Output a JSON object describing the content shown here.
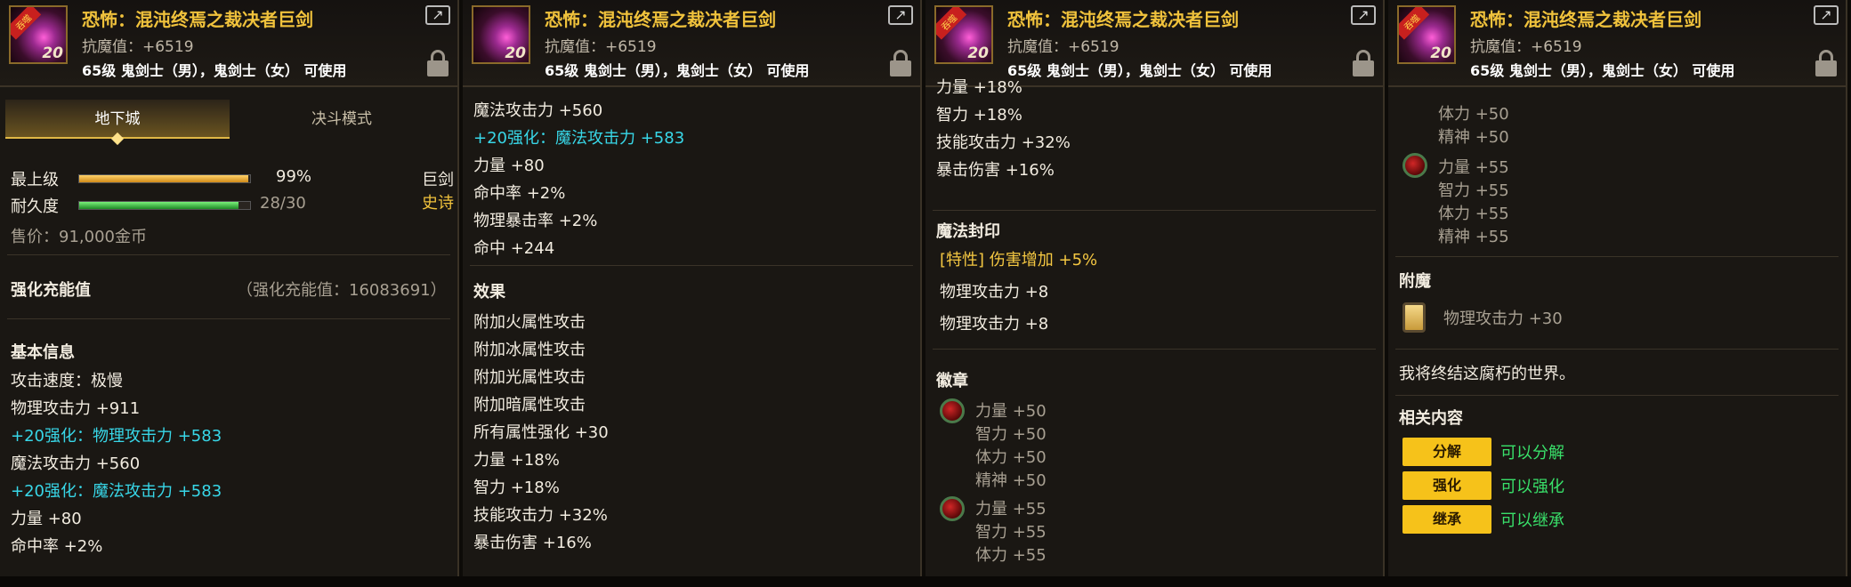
{
  "item": {
    "name": "恐怖：混沌终焉之裁决者巨剑",
    "resist": "抗魔值：+6519",
    "usable": "65级 鬼剑士（男），鬼剑士（女） 可使用",
    "level_badge": "20",
    "icon_tag": "吞噬"
  },
  "panel1": {
    "tabs": [
      "地下城",
      "决斗模式"
    ],
    "grade_label": "最上级",
    "grade_value": "99%",
    "grade_fraction": 0.99,
    "durability_label": "耐久度",
    "durability_value": "28/30",
    "durability_fraction": 0.93,
    "weapon_type": "巨剑",
    "rarity": "史诗",
    "price": "售价：91,000金币",
    "reinforce_label": "强化充能值",
    "reinforce_value": "（强化充能值：16083691）",
    "basic_info_title": "基本信息",
    "stats": [
      {
        "text": "攻击速度：极慢",
        "style": "white"
      },
      {
        "text": "物理攻击力 +911",
        "style": "white"
      },
      {
        "text": "+20强化：物理攻击力 +583",
        "style": "cyan"
      },
      {
        "text": "魔法攻击力 +560",
        "style": "white"
      },
      {
        "text": "+20强化：魔法攻击力 +583",
        "style": "cyan"
      },
      {
        "text": "力量 +80",
        "style": "white"
      },
      {
        "text": "命中率 +2%",
        "style": "white"
      }
    ]
  },
  "panel2": {
    "stats_top": [
      {
        "text": "魔法攻击力 +560",
        "style": "white"
      },
      {
        "text": "+20强化：魔法攻击力 +583",
        "style": "cyan"
      },
      {
        "text": "力量 +80",
        "style": "white"
      },
      {
        "text": "命中率 +2%",
        "style": "white"
      },
      {
        "text": "物理暴击率 +2%",
        "style": "white"
      },
      {
        "text": "命中 +244",
        "style": "white"
      }
    ],
    "effects_title": "效果",
    "effects": [
      "附加火属性攻击",
      "附加冰属性攻击",
      "附加光属性攻击",
      "附加暗属性攻击",
      "所有属性强化 +30",
      "力量 +18%",
      "智力 +18%",
      "技能攻击力 +32%",
      "暴击伤害 +16%"
    ]
  },
  "panel3": {
    "stats_top": [
      "力量 +18%",
      "智力 +18%",
      "技能攻击力 +32%",
      "暴击伤害 +16%"
    ],
    "seal_title": "魔法封印",
    "seal_lines": [
      {
        "text": "[特性] 伤害增加 +5%",
        "style": "yellow"
      },
      {
        "text": "物理攻击力 +8",
        "style": "white"
      },
      {
        "text": "物理攻击力 +8",
        "style": "white"
      }
    ],
    "emblem_title": "徽章",
    "emblem1": [
      "力量 +50",
      "智力 +50",
      "体力 +50",
      "精神 +50"
    ],
    "emblem2": [
      "力量 +55",
      "智力 +55",
      "体力 +55"
    ]
  },
  "panel4": {
    "emblem_prev": [
      "体力 +50",
      "精神 +50"
    ],
    "emblem2": [
      "力量 +55",
      "智力 +55",
      "体力 +55",
      "精神 +55"
    ],
    "enchant_title": "附魔",
    "enchant_value": "物理攻击力 +30",
    "flavor": "我将终结这腐朽的世界。",
    "related_title": "相关内容",
    "related": [
      {
        "button": "分解",
        "status": "可以分解"
      },
      {
        "button": "强化",
        "status": "可以强化"
      },
      {
        "button": "继承",
        "status": "可以继承"
      }
    ]
  }
}
